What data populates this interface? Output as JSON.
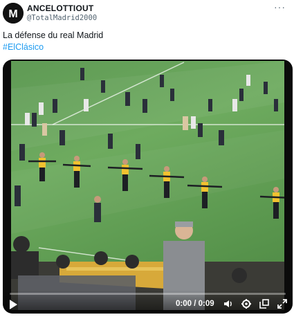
{
  "tweet": {
    "author_name": "ANCELOTTIOUT",
    "author_handle": "@TotalMadrid2000",
    "text": "La défense du real Madrid",
    "hashtag": "#ElClásico",
    "more_icon": "more-horizontal-icon"
  },
  "video": {
    "time": "0:00 / 0:09",
    "progress": 0,
    "icons": {
      "play": "play-icon",
      "volume": "volume-icon",
      "settings": "gear-icon",
      "popout": "popout-icon",
      "fullscreen": "fullscreen-icon"
    }
  }
}
